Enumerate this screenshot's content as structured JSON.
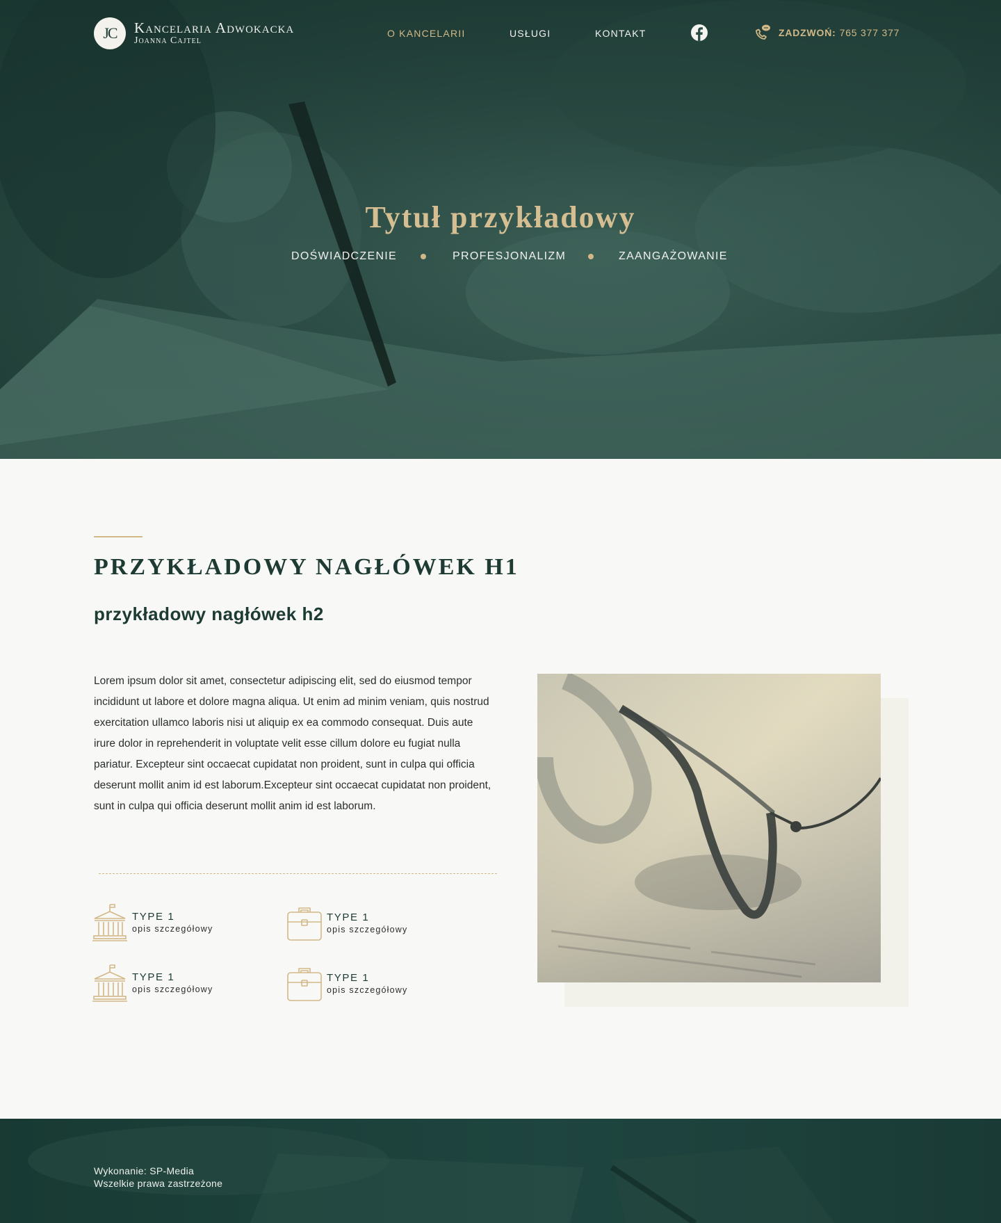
{
  "brand": {
    "monogram": "JC",
    "title": "Kancelaria Adwokacka",
    "subtitle": "Joanna Cajtel"
  },
  "nav": {
    "items": [
      {
        "label": "O KANCELARII",
        "active": true
      },
      {
        "label": "USŁUGI",
        "active": false
      },
      {
        "label": "KONTAKT",
        "active": false
      }
    ],
    "social_icon": "facebook-icon",
    "call_label": "ZADZWOŃ:",
    "call_number": "765 377 377"
  },
  "hero": {
    "title": "Tytuł przykładowy",
    "taglines": [
      "DOŚWIADCZENIE",
      "PROFESJONALIZM",
      "ZAANGAŻOWANIE"
    ]
  },
  "content": {
    "h1": "PRZYKŁADOWY NAGŁÓWEK H1",
    "h2": "przykładowy nagłówek h2",
    "paragraph": "Lorem ipsum dolor sit amet, consectetur adipiscing elit, sed do eiusmod tempor incididunt ut labore et dolore magna aliqua. Ut enim ad minim veniam, quis nostrud exercitation ullamco laboris nisi ut aliquip ex ea commodo consequat. Duis aute irure dolor in reprehenderit in voluptate velit esse cillum dolore eu fugiat nulla pariatur. Excepteur sint occaecat cupidatat non proident, sunt in culpa qui officia deserunt mollit anim id est laborum.Excepteur sint occaecat cupidatat non proident, sunt in culpa qui officia deserunt mollit anim id est laborum.",
    "features": [
      {
        "icon": "courthouse-icon",
        "title": "TYPE 1",
        "desc": "opis szczegółowy"
      },
      {
        "icon": "briefcase-icon",
        "title": "TYPE 1",
        "desc": "opis szczegółowy"
      },
      {
        "icon": "courthouse-icon",
        "title": "TYPE 1",
        "desc": "opis szczegółowy"
      },
      {
        "icon": "briefcase-icon",
        "title": "TYPE 1",
        "desc": "opis szczegółowy"
      }
    ]
  },
  "footer": {
    "credit": "Wykonanie: SP-Media",
    "rights": "Wszelkie prawa zastrzeżone"
  },
  "colors": {
    "accent_gold": "#d2b887",
    "dark_green": "#1d3a33",
    "hero_green": "#2b4c44",
    "background": "#f8f8f7"
  }
}
